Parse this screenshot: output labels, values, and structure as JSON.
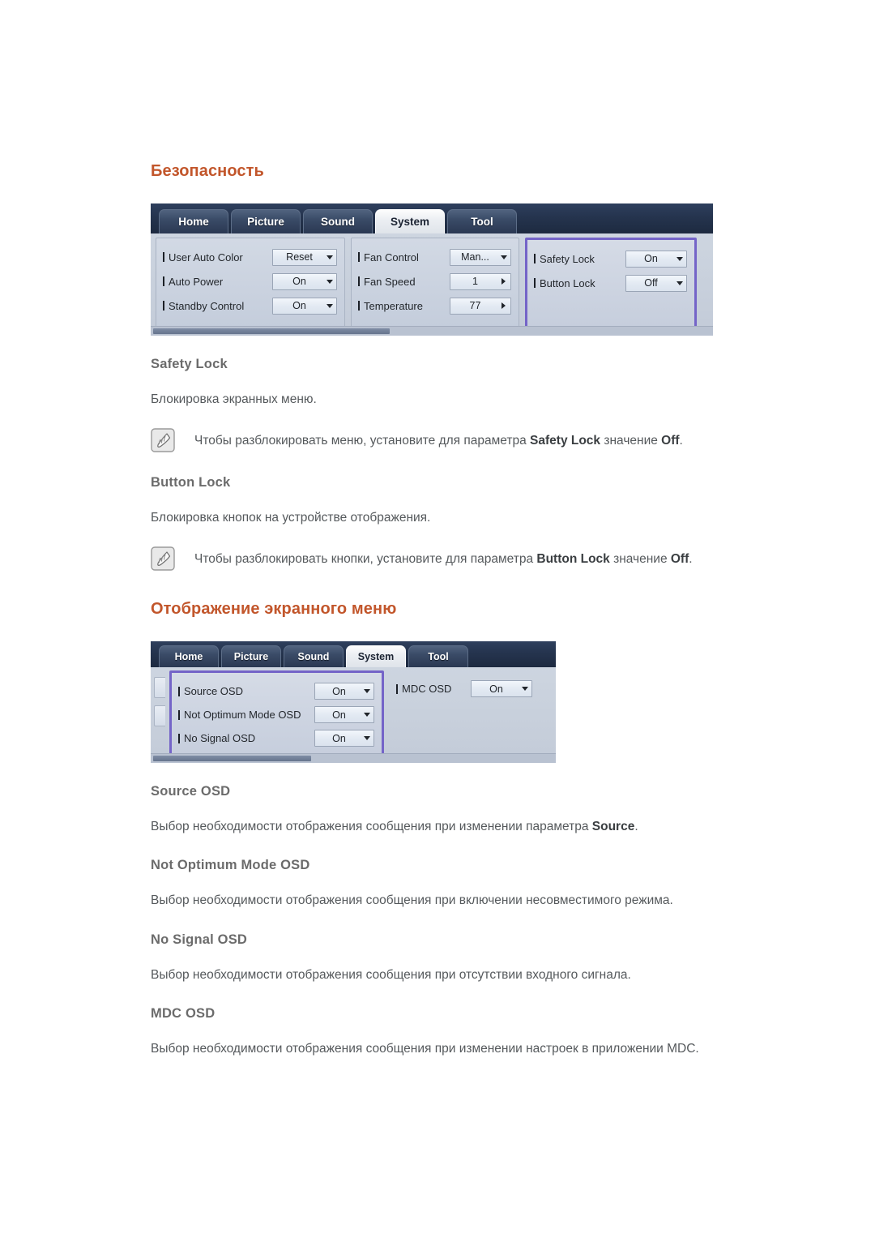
{
  "sections": [
    {
      "heading": "Безопасность",
      "mdc": {
        "tabs": [
          {
            "label": "Home",
            "active": false
          },
          {
            "label": "Picture",
            "active": false
          },
          {
            "label": "Sound",
            "active": false
          },
          {
            "label": "System",
            "active": true
          },
          {
            "label": "Tool",
            "active": false
          }
        ],
        "panels": [
          {
            "highlighted": false,
            "rows": [
              {
                "label": "User Auto Color",
                "value": "Reset",
                "control": "dropdown"
              },
              {
                "label": "Auto Power",
                "value": "On",
                "control": "dropdown"
              },
              {
                "label": "Standby Control",
                "value": "On",
                "control": "dropdown"
              }
            ]
          },
          {
            "highlighted": false,
            "rows": [
              {
                "label": "Fan Control",
                "value": "Man...",
                "control": "dropdown"
              },
              {
                "label": "Fan Speed",
                "value": "1",
                "control": "spinner"
              },
              {
                "label": "Temperature",
                "value": "77",
                "control": "spinner"
              }
            ]
          },
          {
            "highlighted": true,
            "rows": [
              {
                "label": "Safety Lock",
                "value": "On",
                "control": "dropdown"
              },
              {
                "label": "Button Lock",
                "value": "Off",
                "control": "dropdown"
              }
            ]
          }
        ]
      },
      "items": [
        {
          "title": "Safety Lock",
          "description": "Блокировка экранных меню.",
          "note": {
            "icon": "note-pencil-icon",
            "prefix": "Чтобы разблокировать меню, установите для параметра ",
            "bold1": "Safety Lock",
            "middle": " значение ",
            "bold2": "Off",
            "suffix": "."
          }
        },
        {
          "title": "Button Lock",
          "description": "Блокировка кнопок на устройстве отображения.",
          "note": {
            "icon": "note-pencil-icon",
            "prefix": "Чтобы разблокировать кнопки, установите для параметра ",
            "bold1": "Button Lock",
            "middle": " значение ",
            "bold2": "Off",
            "suffix": "."
          }
        }
      ]
    },
    {
      "heading": "Отображение экранного меню",
      "mdc": {
        "tabs": [
          {
            "label": "Home",
            "active": false
          },
          {
            "label": "Picture",
            "active": false
          },
          {
            "label": "Sound",
            "active": false
          },
          {
            "label": "System",
            "active": true
          },
          {
            "label": "Tool",
            "active": false
          }
        ],
        "panels": [
          {
            "highlighted": true,
            "rows": [
              {
                "label": "Source OSD",
                "value": "On",
                "control": "dropdown"
              },
              {
                "label": "Not Optimum Mode OSD",
                "value": "On",
                "control": "dropdown"
              },
              {
                "label": "No Signal OSD",
                "value": "On",
                "control": "dropdown"
              }
            ]
          },
          {
            "highlighted": false,
            "rows": [
              {
                "label": "MDC OSD",
                "value": "On",
                "control": "dropdown"
              }
            ]
          }
        ]
      },
      "items": [
        {
          "title": "Source OSD",
          "description_prefix": "Выбор необходимости отображения сообщения при изменении параметра ",
          "description_bold": "Source",
          "description_suffix": "."
        },
        {
          "title": "Not Optimum Mode OSD",
          "description": "Выбор необходимости отображения сообщения при включении несовместимого режима."
        },
        {
          "title": "No Signal OSD",
          "description": "Выбор необходимости отображения сообщения при отсутствии входного сигнала."
        },
        {
          "title": "MDC OSD",
          "description": "Выбор необходимости отображения сообщения при изменении настроек в приложении MDC."
        }
      ]
    }
  ],
  "colors": {
    "heading_orange": "#c2562b",
    "body_gray": "#55595c",
    "highlight_purple": "#7464c8",
    "tabbar_navy": "#25344e"
  }
}
